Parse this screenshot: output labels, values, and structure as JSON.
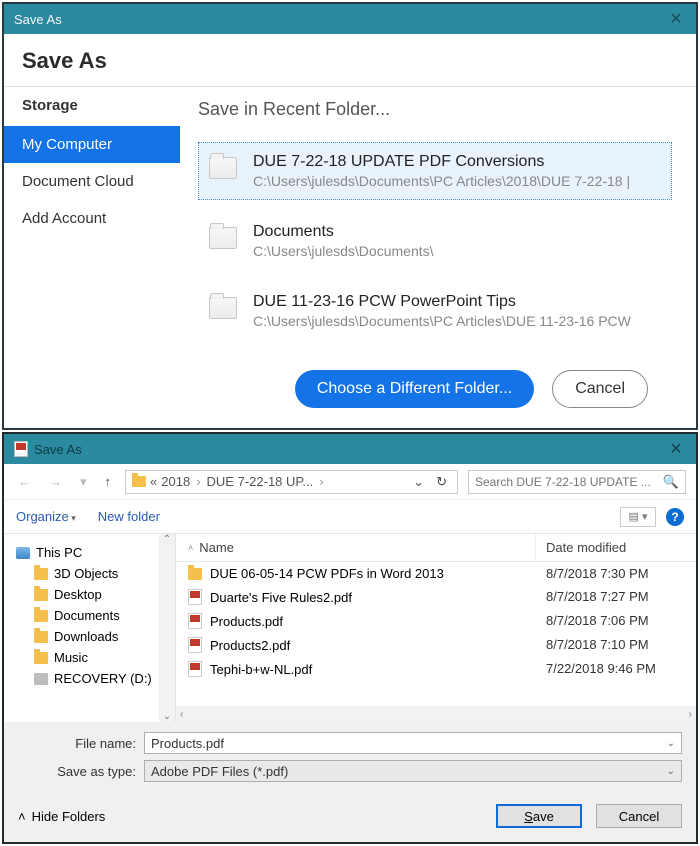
{
  "dlg1": {
    "title": "Save As",
    "heading": "Save As",
    "storage_label": "Storage",
    "sidebar": {
      "items": [
        {
          "label": "My Computer",
          "selected": true
        },
        {
          "label": "Document Cloud",
          "selected": false
        },
        {
          "label": "Add Account",
          "selected": false
        }
      ]
    },
    "main_heading": "Save in Recent Folder...",
    "folders": [
      {
        "name": "DUE 7-22-18 UPDATE PDF Conversions",
        "path": "C:\\Users\\julesds\\Documents\\PC Articles\\2018\\DUE 7-22-18 |",
        "selected": true
      },
      {
        "name": "Documents",
        "path": "C:\\Users\\julesds\\Documents\\",
        "selected": false
      },
      {
        "name": "DUE 11-23-16 PCW PowerPoint Tips",
        "path": "C:\\Users\\julesds\\Documents\\PC Articles\\DUE 11-23-16 PCW",
        "selected": false
      }
    ],
    "buttons": {
      "choose": "Choose a Different Folder...",
      "cancel": "Cancel"
    }
  },
  "dlg2": {
    "title": "Save As",
    "breadcrumbs": {
      "prefix": "«",
      "items": [
        "2018",
        "DUE 7-22-18 UP..."
      ]
    },
    "search_placeholder": "Search DUE 7-22-18 UPDATE ...",
    "toolbar": {
      "organize": "Organize",
      "new_folder": "New folder"
    },
    "tree": [
      {
        "label": "This PC",
        "icon": "pc",
        "level": 1
      },
      {
        "label": "3D Objects",
        "icon": "yellow",
        "level": 2
      },
      {
        "label": "Desktop",
        "icon": "yellow",
        "level": 2
      },
      {
        "label": "Documents",
        "icon": "yellow",
        "level": 2
      },
      {
        "label": "Downloads",
        "icon": "yellow",
        "level": 2
      },
      {
        "label": "Music",
        "icon": "yellow",
        "level": 2
      },
      {
        "label": "RECOVERY (D:)",
        "icon": "grey",
        "level": 2
      }
    ],
    "columns": {
      "name": "Name",
      "date": "Date modified"
    },
    "files": [
      {
        "name": "DUE 06-05-14 PCW PDFs in Word 2013",
        "date": "8/7/2018 7:30 PM",
        "icon": "folder"
      },
      {
        "name": "Duarte's Five Rules2.pdf",
        "date": "8/7/2018 7:27 PM",
        "icon": "pdf"
      },
      {
        "name": "Products.pdf",
        "date": "8/7/2018 7:06 PM",
        "icon": "pdf"
      },
      {
        "name": "Products2.pdf",
        "date": "8/7/2018 7:10 PM",
        "icon": "pdf"
      },
      {
        "name": "Tephi-b+w-NL.pdf",
        "date": "7/22/2018 9:46 PM",
        "icon": "pdf"
      }
    ],
    "fields": {
      "filename_label": "File name:",
      "filename_value": "Products.pdf",
      "saveas_label": "Save as type:",
      "saveas_value": "Adobe PDF Files (*.pdf)"
    },
    "footer": {
      "hide_folders": "Hide Folders",
      "save": "Save",
      "cancel": "Cancel"
    }
  }
}
